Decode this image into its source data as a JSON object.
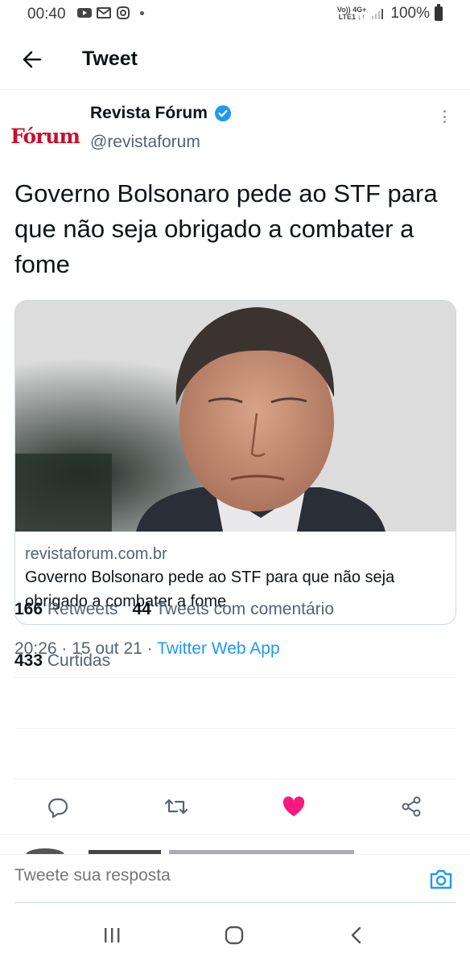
{
  "status_bar": {
    "time": "00:40",
    "notifications": [
      "youtube-icon",
      "gmail-icon",
      "instagram-icon"
    ],
    "network_top": "Vo)) 4G+",
    "network_bottom": "LTE1 ↓↑",
    "battery": "100%"
  },
  "header": {
    "title": "Tweet"
  },
  "tweet": {
    "avatar_text": "Fórum",
    "display_name": "Revista Fórum",
    "verified": true,
    "handle": "@revistaforum",
    "text": "Governo Bolsonaro pede ao STF para que não seja obrigado a combater a fome",
    "card": {
      "domain": "revistaforum.com.br",
      "title": "Governo Bolsonaro pede ao STF para que não seja obrigado a combater a fome"
    },
    "time": "20:26",
    "date": "15 out 21",
    "source": "Twitter Web App",
    "retweets_count": "166",
    "retweets_label": "Retweets",
    "quotes_count": "44",
    "quotes_label": "Tweets com comentário",
    "likes_count": "433",
    "likes_label": "Curtidas",
    "liked": true
  },
  "reply": {
    "placeholder": "Tweete sua resposta"
  },
  "colors": {
    "accent": "#1d9bf0",
    "like": "#f91880",
    "brand": "#c8102e"
  }
}
